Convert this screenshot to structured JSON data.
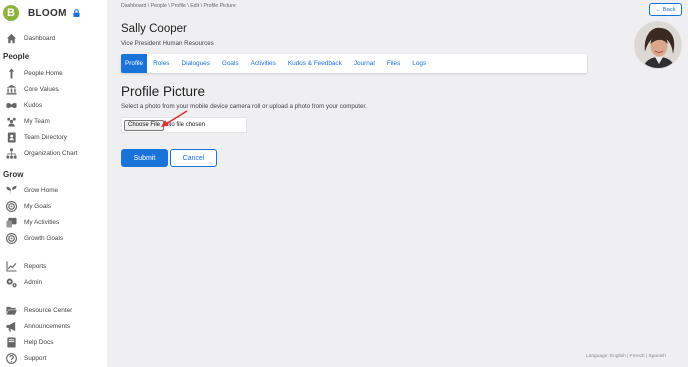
{
  "brand": {
    "name": "BLOOM",
    "logo_letter": "B"
  },
  "sidebar": {
    "items_top": [
      {
        "label": "Dashboard",
        "icon": "home-icon"
      }
    ],
    "sections": [
      {
        "heading": "People",
        "items": [
          {
            "label": "People Home",
            "icon": "person-up-icon"
          },
          {
            "label": "Core Values",
            "icon": "temple-icon"
          },
          {
            "label": "Kudos",
            "icon": "handshake-icon"
          },
          {
            "label": "My Team",
            "icon": "team-icon"
          },
          {
            "label": "Team Directory",
            "icon": "contact-book-icon"
          },
          {
            "label": "Organization Chart",
            "icon": "org-chart-icon"
          }
        ]
      },
      {
        "heading": "Grow",
        "items": [
          {
            "label": "Grow Home",
            "icon": "sprout-icon"
          },
          {
            "label": "My Goals",
            "icon": "target-icon"
          },
          {
            "label": "My Activities",
            "icon": "activities-icon"
          },
          {
            "label": "Growth Goals",
            "icon": "target-icon"
          }
        ]
      }
    ],
    "items_bottom": [
      {
        "label": "Reports",
        "icon": "line-chart-icon"
      },
      {
        "label": "Admin",
        "icon": "gears-icon"
      },
      {
        "label": "Resource Center",
        "icon": "folder-open-icon"
      },
      {
        "label": "Announcements",
        "icon": "megaphone-icon"
      },
      {
        "label": "Help Docs",
        "icon": "book-icon"
      },
      {
        "label": "Support",
        "icon": "question-circle-icon"
      }
    ]
  },
  "breadcrumb": "Dashboard \\ People \\ Profile \\ Edit \\ Profile Picture",
  "back_button": "← Back",
  "person": {
    "name": "Sally Cooper",
    "title": "Vice President Human Resources"
  },
  "tabs": [
    "Profile",
    "Roles",
    "Dialogues",
    "Goals",
    "Activities",
    "Kudos & Feedback",
    "Journal",
    "Files",
    "Logs"
  ],
  "active_tab": "Profile",
  "section": {
    "title": "Profile Picture",
    "description": "Select a photo from your mobile device camera roll or upload a photo from your computer."
  },
  "file_input": {
    "button_label": "Choose File",
    "status": "No file chosen"
  },
  "actions": {
    "submit": "Submit",
    "cancel": "Cancel"
  },
  "footer": {
    "language": "Language: English | French | Spanish"
  },
  "colors": {
    "accent": "#1a73d9",
    "brand_green": "#8db33a",
    "arrow": "#d93030"
  }
}
